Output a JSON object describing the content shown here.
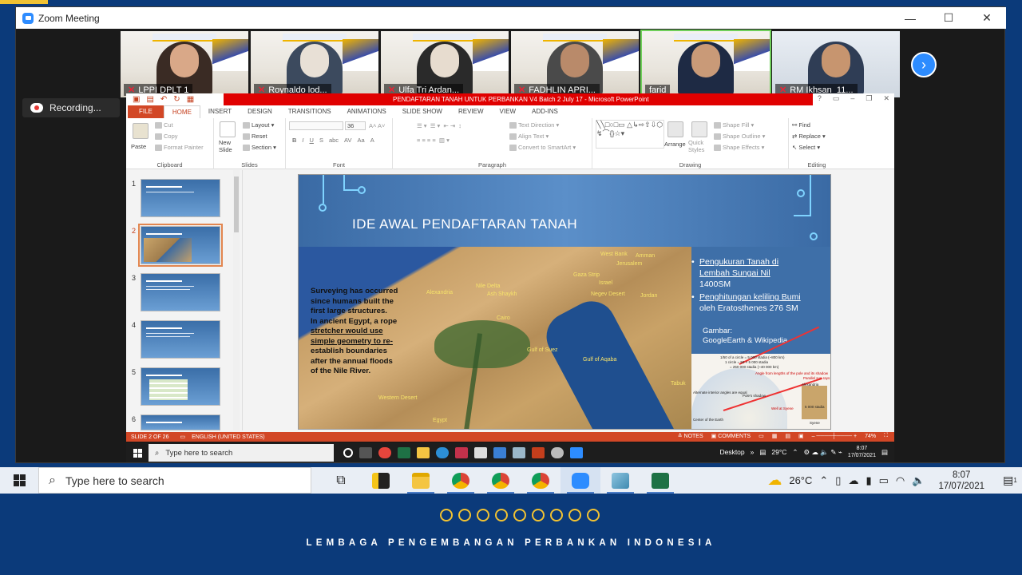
{
  "zoom": {
    "title": "Zoom Meeting",
    "window_controls": [
      "—",
      "☐",
      "✕"
    ],
    "participants": [
      {
        "name": "LPPI DPLT 1",
        "muted": true,
        "active": false
      },
      {
        "name": "Roynaldo lod...",
        "muted": true,
        "active": false
      },
      {
        "name": "Ulfa Tri Ardan...",
        "muted": true,
        "active": false
      },
      {
        "name": "FADHLIN APRI...",
        "muted": true,
        "active": false
      },
      {
        "name": "farid",
        "muted": false,
        "active": true
      },
      {
        "name": "RM Ikhsan_11...",
        "muted": true,
        "active": false
      }
    ],
    "next_label": "›",
    "recording_label": "Recording..."
  },
  "ppt": {
    "title": "PENDAFTARAN TANAH UNTUK PERBANKAN V4 Batch 2 July 17 - Microsoft PowerPoint",
    "title_controls": [
      "?",
      "▭",
      "–",
      "❐",
      "✕"
    ],
    "tabs": [
      "FILE",
      "HOME",
      "INSERT",
      "DESIGN",
      "TRANSITIONS",
      "ANIMATIONS",
      "SLIDE SHOW",
      "REVIEW",
      "VIEW",
      "ADD-INS"
    ],
    "ribbon": {
      "clipboard": {
        "paste": "Paste",
        "cut": "Cut",
        "copy": "Copy",
        "format_painter": "Format Painter",
        "label": "Clipboard"
      },
      "slides": {
        "new_slide": "New Slide",
        "layout": "Layout",
        "reset": "Reset",
        "section": "Section",
        "label": "Slides"
      },
      "font": {
        "size": "36",
        "label": "Font",
        "buttons": [
          "B",
          "I",
          "U",
          "S",
          "abc",
          "AV",
          "Aa",
          "A"
        ]
      },
      "paragraph": {
        "text_direction": "Text Direction",
        "align_text": "Align Text",
        "convert_smartart": "Convert to SmartArt",
        "label": "Paragraph"
      },
      "drawing": {
        "arrange": "Arrange",
        "quick_styles": "Quick Styles",
        "shape_fill": "Shape Fill",
        "shape_outline": "Shape Outline",
        "shape_effects": "Shape Effects",
        "label": "Drawing"
      },
      "editing": {
        "find": "Find",
        "replace": "Replace",
        "select": "Select",
        "label": "Editing"
      }
    },
    "thumbnails": [
      "1",
      "2",
      "3",
      "4",
      "5",
      "6"
    ],
    "selected_slide": 2,
    "slide": {
      "title": "IDE AWAL PENDAFTARAN TANAH",
      "map_text": [
        "Surveying has occurred",
        "since humans built the",
        "first large structures.",
        "In ancient Egypt, a rope",
        "stretcher would use",
        "simple geometry to re-",
        "establish boundaries",
        "after the annual floods",
        "of the Nile River."
      ],
      "map_labels": [
        "West Bank",
        "Amman",
        "Jerusalem",
        "Gaza Strip",
        "Israel",
        "Jordan",
        "Alexandria",
        "Nile Delta",
        "Ash Shaykh",
        "Cairo",
        "Negev Desert",
        "Gulf of Suez",
        "Gulf of Aqaba",
        "Tabuk",
        "Western Desert",
        "Egypt"
      ],
      "bullets": [
        {
          "line1": "Pengukuran Tanah di",
          "line2": "Lembah Sungai Nil",
          "line3": "1400SM"
        },
        {
          "line1": "Penghitungan keliling Bumi",
          "line2": "oleh Eratosthenes 276 SM"
        }
      ],
      "source_label": "Gambar:",
      "source_value": "GoogleEarth",
      "source_suffix": " & Wikipedia",
      "diagram_labels": [
        "1/50 of a circle = 5 000 stadia (~800 km)",
        "1 circle = 50 × 5 000 stadia",
        "= 250 000 stadia (~40 000 km)",
        "Angle from lengths of the pole and its shadow",
        "Parallel sun rays",
        "Alternate interior angles are equal",
        "Center of the Earth",
        "Pole's shadow",
        "Well at Syene",
        "Alexandria",
        "5 000 stadia",
        "Syene"
      ]
    },
    "status": {
      "slide": "SLIDE 2 OF 26",
      "language": "ENGLISH (UNITED STATES)",
      "notes": "NOTES",
      "comments": "COMMENTS",
      "zoom": "74%"
    }
  },
  "remote_taskbar": {
    "search": "Type here to search",
    "desktop": "Desktop",
    "temp": "29°C",
    "time": "8:07",
    "date": "17/07/2021"
  },
  "taskbar": {
    "search": "Type here to search",
    "temp": "26°C",
    "time": "8:07",
    "date": "17/07/2021",
    "notifications": "1"
  },
  "footer": {
    "org": "LEMBAGA PENGEMBANGAN PERBANKAN INDONESIA"
  },
  "colors": {
    "brand_blue": "#0b3a7a",
    "gold": "#f1c232",
    "zoom_blue": "#2d8cff",
    "ppt_orange": "#d24726"
  }
}
